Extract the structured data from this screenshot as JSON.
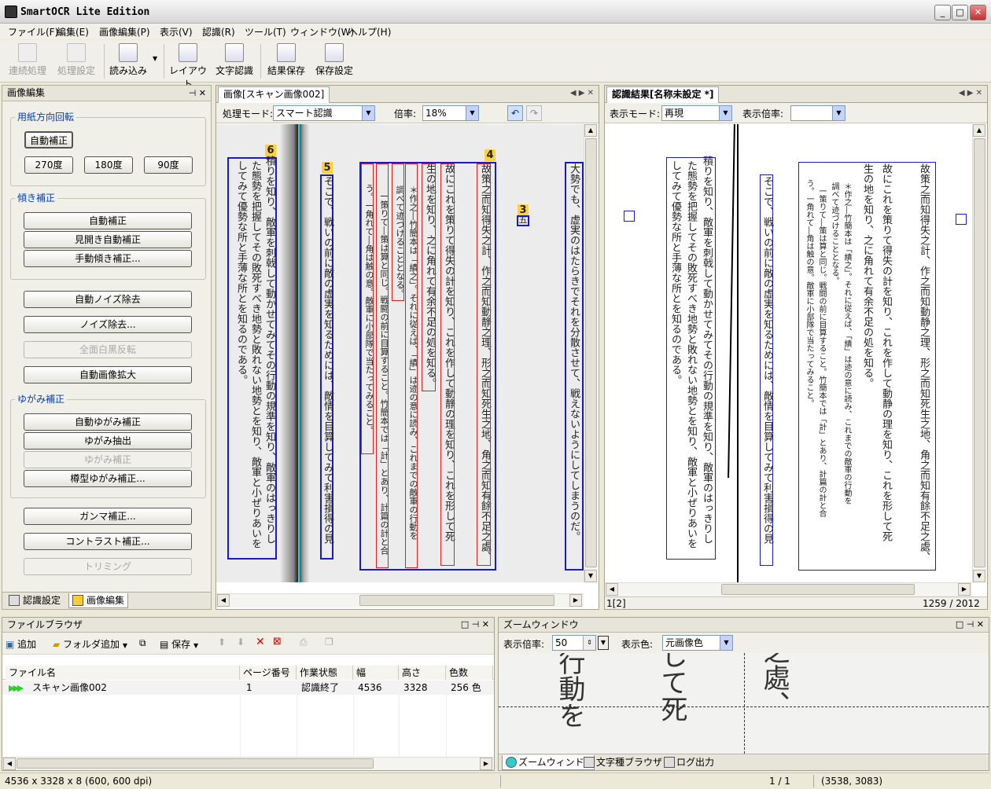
{
  "app": {
    "title": "SmartOCR Lite Edition"
  },
  "menu": [
    "ファイル(F)",
    "編集(E)",
    "画像編集(P)",
    "表示(V)",
    "認識(R)",
    "ツール(T)",
    "ウィンドウ(W)",
    "ヘルプ(H)"
  ],
  "toolbar": {
    "batch": "連続処理",
    "proc_settings": "処理設定",
    "load": "読み込み",
    "layout": "レイアウト",
    "recognize": "文字認識",
    "save_result": "結果保存",
    "save_settings": "保存設定"
  },
  "left_panel": {
    "title": "画像編集",
    "rotation_group": "用紙方向回転",
    "auto_correct": "自動補正",
    "rot270": "270度",
    "rot180": "180度",
    "rot90": "90度",
    "skew_group": "傾き補正",
    "skew_auto": "自動補正",
    "skew_spread": "見開き自動補正",
    "skew_manual": "手動傾き補正...",
    "noise_auto": "自動ノイズ除去",
    "noise_remove": "ノイズ除去...",
    "invert": "全面白黒反転",
    "auto_enlarge": "自動画像拡大",
    "warp_group": "ゆがみ補正",
    "warp_auto": "自動ゆがみ補正",
    "warp_extract": "ゆがみ抽出",
    "warp_correct": "ゆがみ補正",
    "barrel": "樽型ゆがみ補正...",
    "gamma": "ガンマ補正...",
    "contrast": "コントラスト補正...",
    "trim": "トリミング",
    "tab_recog": "認識設定",
    "tab_edit": "画像編集"
  },
  "image_pane": {
    "tab": "画像[スキャン画像002]",
    "mode_label": "処理モード:",
    "mode_value": "スマート認識",
    "zoom_label": "倍率:",
    "zoom_value": "18%",
    "labels": [
      "6",
      "5",
      "4",
      "3"
    ],
    "col_a": "故策之而知得失之計、作之而知動静之理、形之而知死生之地、角之而知有餘不足之處、",
    "col_b": "故にこれを策りて得失の計を知り、これを作して動静の理を知り、これを形して死",
    "col_c": "生の地を知り、之に角れて有余不足の処を知る。",
    "col_d": "＊作之―竹簡本は「績之」。それに従えば、「績」は迹の意に読み、これまでの敵軍の行動を",
    "col_e": "調べて迹づけることとなる。",
    "col_f": "一策りて―策は算と同じ。戦闘の前に目算すること。竹簡本では「計」とあり、計篇の計と合",
    "col_g": "う。一角れて―角は触の意。敵軍に小部隊で当たってみること。",
    "col_h": "そこで、戦いの前に敵の虚実を知るためには、敵情を目算してみて利害損得の見",
    "col_i": "積りを知り、敵軍を刺戟して動かせてみてその行動の規準を知り、敵軍のはっきりし",
    "col_j": "た態勢を把握してその敗死すべき地勢と敗れない地勢とを知り、敵軍と小ぜりあいを",
    "col_k": "してみて優勢な所と手薄な所とを知るのである。",
    "col_l": "大勢でも、虚実のはたらきでそれを分散させて、戦えないようにしてしまうのだ。",
    "col_m": "五"
  },
  "result_pane": {
    "tab": "認識結果[名称未設定 *]",
    "mode_label": "表示モード:",
    "mode_value": "再現",
    "zoom_label": "表示倍率:",
    "zoom_value": "",
    "page_info": "1[2]",
    "coord_info": "1259 / 2012",
    "col_a": "故策之而知得失之計、作之而知動静之理、形之而知死生之地、角之而知有餘不足之處、",
    "col_b": "故にこれを策りて得失の計を知り、これを作して動静の理を知り、これを形して死",
    "col_c": "生の地を知り、之に角れて有余不足の処を知る。",
    "col_d": "＊作之―竹簡本は「績之」。それに従えば、「績」は迹の意に読み、これまでの敵軍の行動を",
    "col_e": "調べて迹づけることとなる。",
    "col_f": "一策りて―策は算と同じ。戦闘の前に目算すること。竹簡本では「計」とあり、計篇の計と合",
    "col_g": "う。一角れて―角は触の意。敵軍に小部隊で当たってみること。",
    "col_h": "そこで、戦いの前に敵の虚実を知るためには、敵情を目算してみて利害損得の見",
    "col_i": "積りを知り、敵軍を刺戟して動かせてみてその行動の規準を知り、敵軍のはっきりし",
    "col_j": "た態勢を把握してその敗死すべき地勢と敗れない地勢とを知り、敵軍と小ぜりあいを",
    "col_k": "してみて優勢な所と手薄な所とを知るのである。"
  },
  "file_browser": {
    "title": "ファイルブラウザ",
    "add": "追加",
    "add_folder": "フォルダ追加",
    "save": "保存",
    "columns": [
      "ファイル名",
      "ページ番号",
      "作業状態",
      "幅",
      "高さ",
      "色数"
    ],
    "rows": [
      {
        "name": "スキャン画像002",
        "page": "1",
        "status": "認識終了",
        "width": "4536",
        "height": "3328",
        "colors": "256 色"
      }
    ]
  },
  "zoom_window": {
    "title": "ズームウィンドウ",
    "zoom_label": "表示倍率:",
    "zoom_value": "50",
    "color_label": "表示色:",
    "color_value": "元画像色",
    "preview_cols": [
      "行動を",
      "して死",
      "之處、"
    ],
    "tabs": [
      "ズームウィンドウ",
      "文字種ブラウザ",
      "ログ出力"
    ]
  },
  "status": {
    "image_info": "4536 x 3328 x 8 (600, 600 dpi)",
    "page": "1 / 1",
    "coords": "(3538, 3083)"
  }
}
